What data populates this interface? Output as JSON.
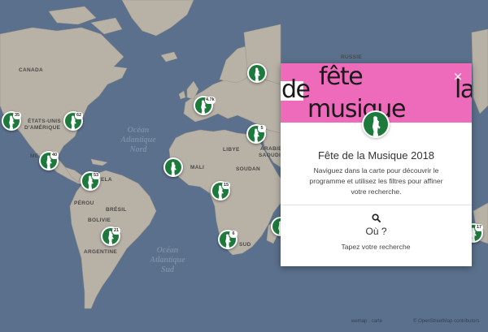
{
  "map": {
    "country_labels": {
      "russie": "RUSSIE",
      "canada": "CANADA",
      "etats_unis_1": "ÉTATS-UNIS",
      "etats_unis_2": "D'AMÉRIQUE",
      "mexique": "ME",
      "libye": "LIBYE",
      "mali": "MALI",
      "soudan": "SOUDAN",
      "arabie_1": "ARABIE",
      "arabie_2": "SAOUDITE",
      "venezuela": "ELA",
      "perou": "PÉROU",
      "bresil": "BRÉSIL",
      "bolivie": "BOLIVIE",
      "argentine": "ARGENTINE",
      "afrique_sud": "SUD"
    },
    "ocean_labels": {
      "atlantique_nord_1": "Océan",
      "atlantique_nord_2": "Atlantique",
      "atlantique_nord_3": "Nord",
      "atlantique_sud_1": "Océan",
      "atlantique_sud_2": "Atlantique",
      "atlantique_sud_3": "Sud"
    },
    "colors": {
      "ocean": "#5b708c",
      "land": "#b7b1a6",
      "marker_green": "#1e7a3c",
      "banner_pink": "#ee6aba"
    },
    "markers": [
      {
        "name": "us-west",
        "count": "35"
      },
      {
        "name": "us-east",
        "count": "62"
      },
      {
        "name": "mexico",
        "count": "40"
      },
      {
        "name": "colombia",
        "count": "53"
      },
      {
        "name": "brazil-south",
        "count": "21"
      },
      {
        "name": "scandinavia",
        "count": ""
      },
      {
        "name": "western-europe",
        "count": "4.7k"
      },
      {
        "name": "turkey",
        "count": "5"
      },
      {
        "name": "west-africa",
        "count": ""
      },
      {
        "name": "central-africa",
        "count": "15"
      },
      {
        "name": "southern-africa",
        "count": "6"
      },
      {
        "name": "east-africa-edge",
        "count": ""
      },
      {
        "name": "asia-edge",
        "count": "17"
      }
    ]
  },
  "panel": {
    "wordmark": {
      "fete": "fête",
      "de": "de",
      "la": "la",
      "musique": "musique"
    },
    "close_label": "×",
    "title": "Fête de la Musique 2018",
    "description": "Naviguez dans la carte pour découvrir le programme et utilisez les filtres pour affiner votre recherche.",
    "search_icon": "search-icon",
    "search_heading": "Où ?",
    "search_placeholder": "Tapez votre recherche"
  },
  "attribution": {
    "left": "wemap · carte",
    "right": "© OpenStreetMap contributors"
  }
}
